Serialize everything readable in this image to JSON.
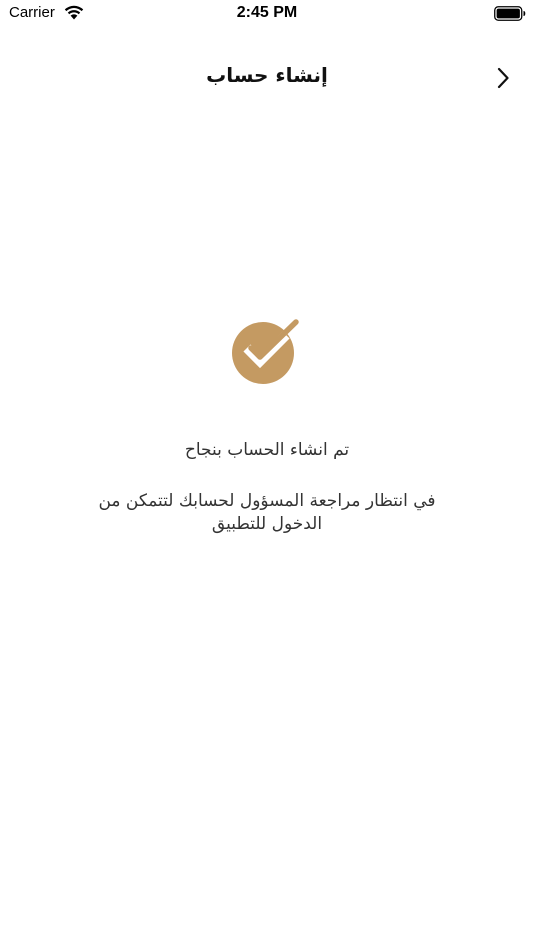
{
  "status_bar": {
    "carrier": "Carrier",
    "time": "2:45 PM"
  },
  "nav": {
    "title": "إنشاء حساب",
    "back_icon": "chevron-right-icon"
  },
  "content": {
    "icon": "check-badge-icon",
    "accent_color": "#c49a62",
    "title": "تم انشاء الحساب بنجاح",
    "body": "في انتظار مراجعة المسؤول لحسابك لتتمكن من الدخول للتطبيق"
  }
}
